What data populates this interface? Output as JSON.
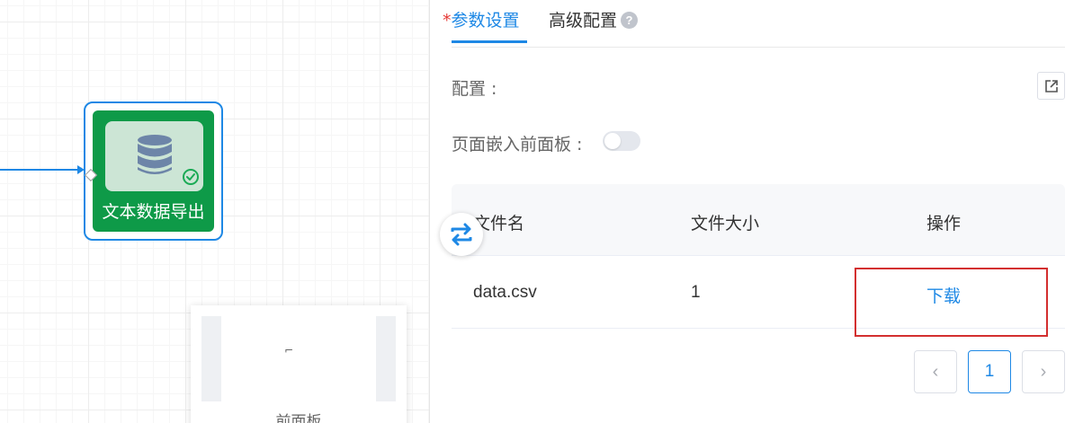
{
  "canvas": {
    "node": {
      "label": "文本数据导出",
      "icon": "database-icon",
      "status_icon": "check-circle-icon"
    },
    "panel_node": {
      "label": "前面板",
      "mini_icon_text": "⌐"
    }
  },
  "tabs": {
    "required_mark": "*",
    "params_label": "参数设置",
    "advanced_label": "高级配置",
    "help_glyph": "?"
  },
  "form": {
    "config_label": "配置 :",
    "embed_label": "页面嵌入前面板 :",
    "embed_enabled": false
  },
  "table": {
    "headers": {
      "name": "文件名",
      "size": "文件大小",
      "op": "操作"
    },
    "rows": [
      {
        "name": "data.csv",
        "size": "1",
        "op": "下载"
      }
    ]
  },
  "pager": {
    "prev": "‹",
    "page": "1",
    "next": "›"
  },
  "colors": {
    "primary": "#1e88e5",
    "node_green": "#0e9a48",
    "highlight": "#d32f2f",
    "required": "#e53935"
  }
}
